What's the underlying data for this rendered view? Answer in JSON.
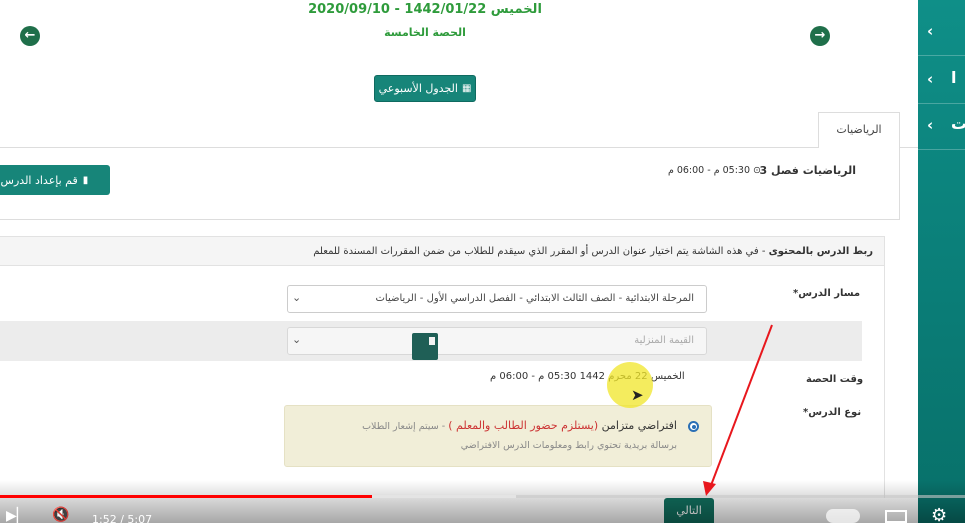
{
  "header": {
    "date_line": "الخميس 1442/01/22 - 2020/09/10",
    "period": "الحصة الخامسة",
    "prev_icon": "arrow-left-circle-icon",
    "next_icon": "arrow-right-circle-icon",
    "weekly_button": "الجدول الأسبوعي",
    "weekly_icon": "calendar-icon"
  },
  "sidebar": {
    "items": [
      {
        "chevron": "‹",
        "text": ""
      },
      {
        "chevron": "‹",
        "text": "ا"
      },
      {
        "chevron": "‹",
        "text": "ت"
      }
    ]
  },
  "tab": {
    "label": "الرياضيات"
  },
  "lesson": {
    "name": "الرياضيات فصل 3",
    "time": "05:30 م - 06:00 م",
    "clock_icon": "clock-icon",
    "prep_button": "قم بإعداد الدرس ا",
    "prep_icon": "book-icon"
  },
  "link_section": {
    "title_bold": "ربط الدرس بالمحتوى",
    "title_rest": " - في هذه الشاشة يتم اختيار عنوان الدرس أو المقرر الذي سيقدم للطلاب من ضمن المقررات المسندة للمعلم"
  },
  "form": {
    "path_label": "مسار الدرس*",
    "path_value": "المرحلة الابتدائية - الصف الثالث الابتدائي - الفصل الدراسي الأول - الرياضيات",
    "homework_value": "القيمة المنزلية",
    "time_label": "وقت الحصة",
    "time_value": "الخميس 22 محرم 1442 05:30 م - 06:00 م",
    "type_label": "نوع الدرس*",
    "type_main": "افتراضي متزامن ",
    "type_red": "(يستلزم حضور الطالب والمعلم )",
    "type_note": " - سيتم إشعار الطلاب",
    "type_sub": "برسالة بريدية تحتوي رابط ومعلومات الدرس الافتراضي"
  },
  "next_button": "التالي",
  "video": {
    "time_readout": "1:52 / 5:07",
    "progress": 0.385,
    "buffered": 0.535
  }
}
